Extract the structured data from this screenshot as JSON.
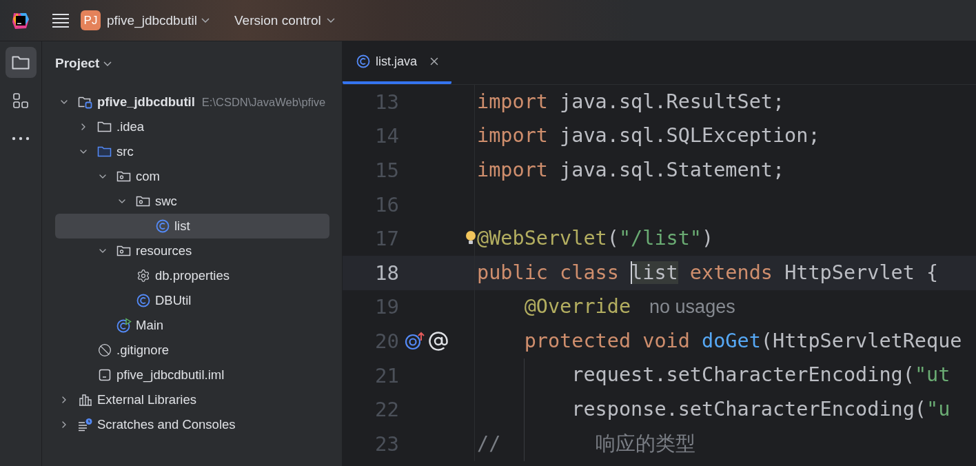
{
  "title_bar": {
    "project_badge": "PJ",
    "project_name": "pfive_jdbcdbutil",
    "vcs_menu": "Version control"
  },
  "tool_strip": [
    {
      "kind": "project",
      "selected": true
    },
    {
      "kind": "structure",
      "selected": false
    },
    {
      "kind": "more",
      "selected": false
    }
  ],
  "project_panel": {
    "title": "Project",
    "tree": [
      {
        "kind": "project",
        "label": "pfive_jdbcdbutil",
        "path": "E:\\CSDN\\JavaWeb\\pfive",
        "expanded": true,
        "selected": false,
        "children": [
          {
            "kind": "folder",
            "label": ".idea",
            "expanded": false,
            "selected": false
          },
          {
            "kind": "source",
            "label": "src",
            "expanded": true,
            "selected": false,
            "children": [
              {
                "kind": "package",
                "label": "com",
                "expanded": true,
                "selected": false,
                "children": [
                  {
                    "kind": "package",
                    "label": "swc",
                    "expanded": true,
                    "selected": false,
                    "children": [
                      {
                        "kind": "class",
                        "label": "list",
                        "selected": true
                      }
                    ]
                  }
                ]
              },
              {
                "kind": "package",
                "label": "resources",
                "expanded": true,
                "selected": false,
                "children": [
                  {
                    "kind": "properties",
                    "label": "db.properties",
                    "selected": false
                  },
                  {
                    "kind": "class",
                    "label": "DBUtil",
                    "selected": false
                  }
                ]
              },
              {
                "kind": "main",
                "label": "Main",
                "selected": false
              }
            ]
          },
          {
            "kind": "ignore",
            "label": ".gitignore",
            "selected": false
          },
          {
            "kind": "iml",
            "label": "pfive_jdbcdbutil.iml",
            "selected": false
          }
        ]
      },
      {
        "kind": "libraries",
        "label": "External Libraries",
        "expanded": false,
        "selected": false
      },
      {
        "kind": "scratches",
        "label": "Scratches and Consoles",
        "expanded": false,
        "selected": false
      }
    ]
  },
  "editor": {
    "tabs": [
      {
        "label": "list.java",
        "selected": true
      }
    ],
    "lines": [
      {
        "number": "13",
        "current": false,
        "bulb": false,
        "indent_guide": false,
        "tokens": [
          {
            "kind": "keyword",
            "text": "import"
          },
          {
            "kind": "plain",
            "text": " java.sql.ResultSet;"
          }
        ]
      },
      {
        "number": "14",
        "current": false,
        "bulb": false,
        "indent_guide": false,
        "tokens": [
          {
            "kind": "keyword",
            "text": "import"
          },
          {
            "kind": "plain",
            "text": " java.sql.SQLException;"
          }
        ]
      },
      {
        "number": "15",
        "current": false,
        "bulb": false,
        "indent_guide": false,
        "tokens": [
          {
            "kind": "keyword",
            "text": "import"
          },
          {
            "kind": "plain",
            "text": " java.sql.Statement;"
          }
        ]
      },
      {
        "number": "16",
        "current": false,
        "bulb": false,
        "indent_guide": false
      },
      {
        "number": "17",
        "current": false,
        "bulb": true,
        "indent_guide": false,
        "tokens": [
          {
            "kind": "annotation",
            "text": "@WebServlet"
          },
          {
            "kind": "plain",
            "text": "("
          },
          {
            "kind": "string",
            "text": "\"/list\""
          },
          {
            "kind": "plain",
            "text": ")"
          }
        ]
      },
      {
        "number": "18",
        "current": true,
        "bulb": false,
        "indent_guide": false,
        "tokens": [
          {
            "kind": "keyword",
            "text": "public class "
          },
          {
            "kind": "caret-word",
            "text": "list"
          },
          {
            "kind": "keyword",
            "text": " extends"
          },
          {
            "kind": "plain",
            "text": " HttpServlet {"
          }
        ]
      },
      {
        "number": "19",
        "current": false,
        "bulb": false,
        "indent_guide": false,
        "tokens": [
          {
            "kind": "annotation",
            "text": "    @Override"
          },
          {
            "kind": "hint",
            "text": "no usages"
          }
        ]
      },
      {
        "number": "20",
        "current": false,
        "bulb": false,
        "indent_guide": false,
        "gutter_icons": [
          {
            "kind": "override"
          },
          {
            "kind": "annotation"
          }
        ],
        "tokens": [
          {
            "kind": "keyword",
            "text": "    protected void "
          },
          {
            "kind": "method",
            "text": "doGet"
          },
          {
            "kind": "plain",
            "text": "(HttpServletReque"
          }
        ]
      },
      {
        "number": "21",
        "current": false,
        "bulb": false,
        "indent_guide": true,
        "tokens": [
          {
            "kind": "plain",
            "text": "        request.setCharacterEncoding("
          },
          {
            "kind": "string",
            "text": "\"ut"
          }
        ]
      },
      {
        "number": "22",
        "current": false,
        "bulb": false,
        "indent_guide": true,
        "tokens": [
          {
            "kind": "plain",
            "text": "        response.setCharacterEncoding("
          },
          {
            "kind": "string",
            "text": "\"u"
          }
        ]
      },
      {
        "number": "23",
        "current": false,
        "bulb": false,
        "indent_guide": true,
        "tokens": [
          {
            "kind": "comment",
            "text": "//"
          },
          {
            "kind": "comment",
            "text": "        响应的类型"
          }
        ]
      }
    ]
  }
}
